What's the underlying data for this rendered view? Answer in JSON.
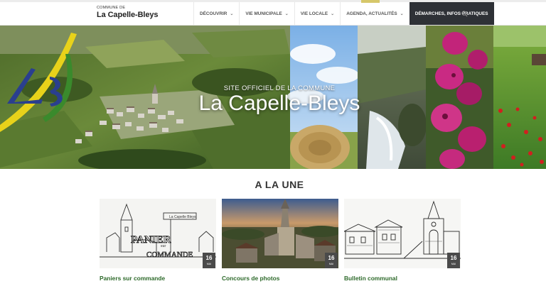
{
  "header": {
    "logo_small": "COMMUNE DE",
    "logo_name": "La Capelle-Bleys",
    "nav": [
      {
        "label": "DÉCOUVRIR",
        "dropdown": true
      },
      {
        "label": "VIE MUNICIPALE",
        "dropdown": true
      },
      {
        "label": "VIE LOCALE",
        "dropdown": true
      },
      {
        "label": "AGENDA, ACTUALITÉS",
        "dropdown": true
      },
      {
        "label": "DÉMARCHES, INFOS PRATIQUES",
        "dropdown": false
      }
    ],
    "search_icon": "search-icon"
  },
  "hero": {
    "kicker": "SITE OFFICIEL DE LA COMMUNE",
    "title": "La Capelle-Bleys",
    "logo_text": "LB"
  },
  "news": {
    "heading": "A LA UNE",
    "cards": [
      {
        "title": "Paniers sur commande",
        "day": "16",
        "month": "mai",
        "sign_text": "La Capelle Bleys",
        "drawing_words": [
          "PANIER",
          "sur",
          "COMMANDE"
        ]
      },
      {
        "title": "Concours de photos",
        "day": "16",
        "month": "mai"
      },
      {
        "title": "Bulletin communal",
        "day": "16",
        "month": "mai"
      }
    ]
  },
  "colors": {
    "nav_dark": "#2e3136",
    "card_title": "#2e6a2b",
    "logo_yellow": "#e8d21a",
    "logo_green": "#3a8a2c",
    "logo_blue": "#2a3f8f"
  }
}
